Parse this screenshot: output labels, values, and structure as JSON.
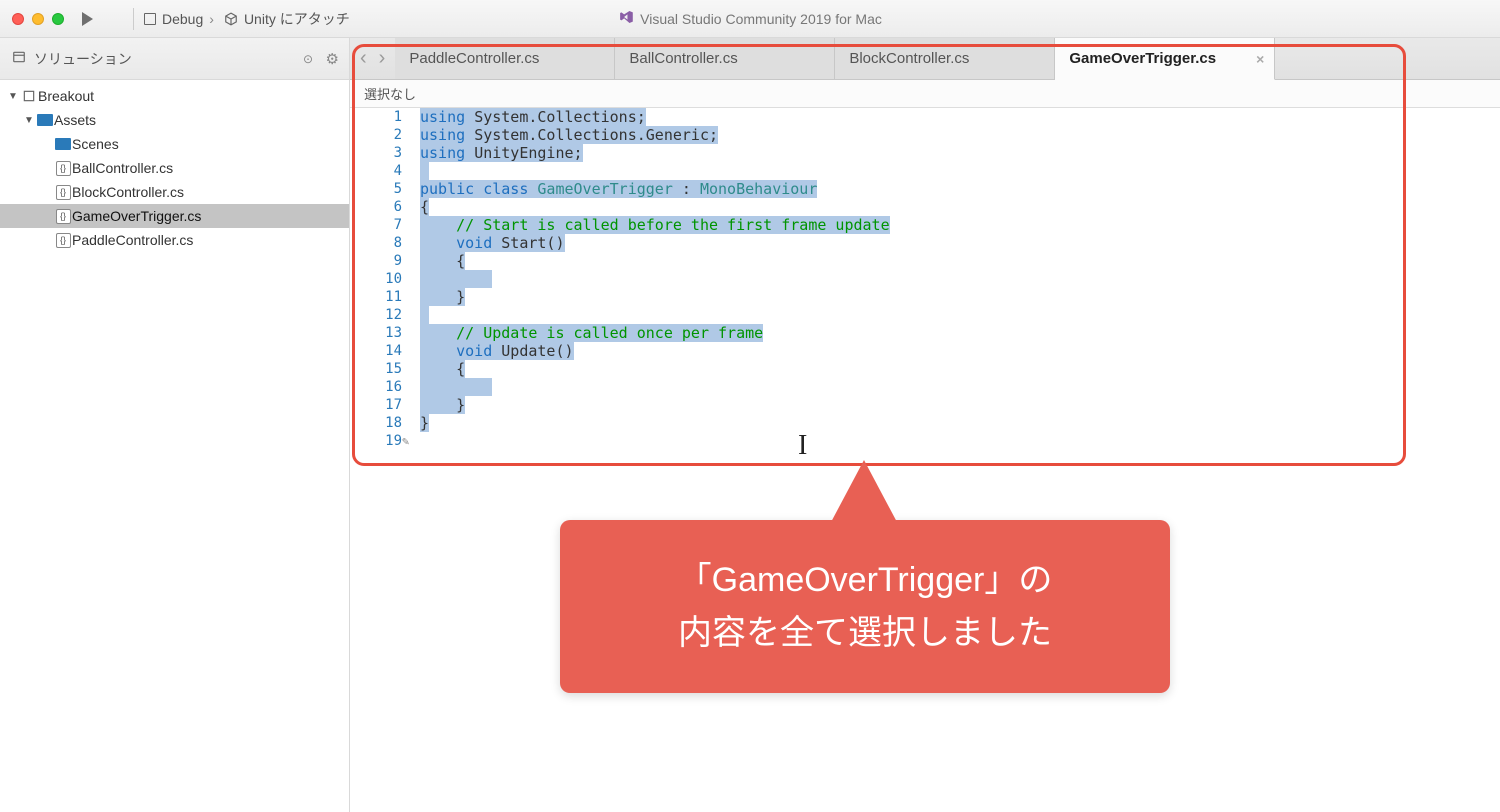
{
  "titlebar": {
    "config_label": "Debug",
    "attach_label": "Unity にアタッチ",
    "app_title": "Visual Studio Community 2019 for Mac"
  },
  "sidebar": {
    "header": "ソリューション",
    "tree": {
      "root": "Breakout",
      "assets": "Assets",
      "scenes": "Scenes",
      "files": [
        "BallController.cs",
        "BlockController.cs",
        "GameOverTrigger.cs",
        "PaddleController.cs"
      ]
    },
    "selected_file": "GameOverTrigger.cs"
  },
  "tabs": [
    {
      "label": "PaddleController.cs",
      "active": false
    },
    {
      "label": "BallController.cs",
      "active": false
    },
    {
      "label": "BlockController.cs",
      "active": false
    },
    {
      "label": "GameOverTrigger.cs",
      "active": true
    }
  ],
  "breadcrumb": "選択なし",
  "code": {
    "line_count": 19,
    "lines": [
      {
        "n": 1,
        "tokens": [
          [
            "kw",
            "using "
          ],
          [
            "str",
            "System.Collections;"
          ]
        ]
      },
      {
        "n": 2,
        "tokens": [
          [
            "kw",
            "using "
          ],
          [
            "str",
            "System.Collections.Generic;"
          ]
        ]
      },
      {
        "n": 3,
        "tokens": [
          [
            "kw",
            "using "
          ],
          [
            "str",
            "UnityEngine;"
          ]
        ]
      },
      {
        "n": 4,
        "tokens": []
      },
      {
        "n": 5,
        "tokens": [
          [
            "kw",
            "public class "
          ],
          [
            "cls",
            "GameOverTrigger"
          ],
          [
            "str",
            " : "
          ],
          [
            "type",
            "MonoBehaviour"
          ]
        ]
      },
      {
        "n": 6,
        "tokens": [
          [
            "str",
            "{"
          ]
        ]
      },
      {
        "n": 7,
        "tokens": [
          [
            "str",
            "    "
          ],
          [
            "cm",
            "// Start is called before the first frame update"
          ]
        ]
      },
      {
        "n": 8,
        "tokens": [
          [
            "str",
            "    "
          ],
          [
            "kw",
            "void"
          ],
          [
            "str",
            " Start()"
          ]
        ]
      },
      {
        "n": 9,
        "tokens": [
          [
            "str",
            "    {"
          ]
        ]
      },
      {
        "n": 10,
        "tokens": [
          [
            "str",
            "        "
          ]
        ]
      },
      {
        "n": 11,
        "tokens": [
          [
            "str",
            "    }"
          ]
        ]
      },
      {
        "n": 12,
        "tokens": []
      },
      {
        "n": 13,
        "tokens": [
          [
            "str",
            "    "
          ],
          [
            "cm",
            "// Update is called once per frame"
          ]
        ]
      },
      {
        "n": 14,
        "tokens": [
          [
            "str",
            "    "
          ],
          [
            "kw",
            "void"
          ],
          [
            "str",
            " Update()"
          ]
        ]
      },
      {
        "n": 15,
        "tokens": [
          [
            "str",
            "    {"
          ]
        ]
      },
      {
        "n": 16,
        "tokens": [
          [
            "str",
            "        "
          ]
        ]
      },
      {
        "n": 17,
        "tokens": [
          [
            "str",
            "    }"
          ]
        ]
      },
      {
        "n": 18,
        "tokens": [
          [
            "str",
            "}"
          ]
        ]
      },
      {
        "n": 19,
        "tokens": []
      }
    ],
    "all_selected": true
  },
  "annotation": {
    "line1": "「GameOverTrigger」の",
    "line2": "内容を全て選択しました"
  }
}
